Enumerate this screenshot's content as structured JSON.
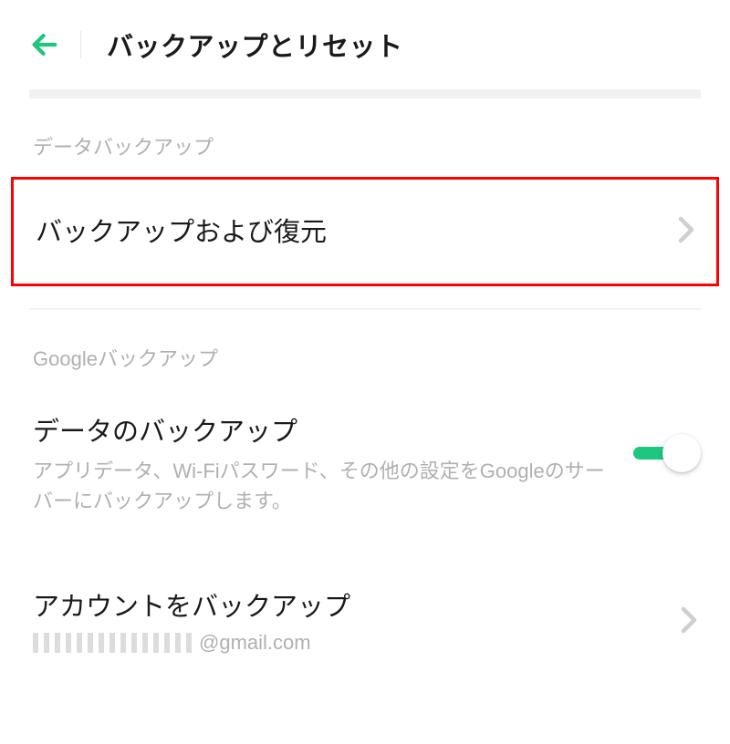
{
  "header": {
    "title": "バックアップとリセット"
  },
  "sections": {
    "data_backup": {
      "label": "データバックアップ",
      "item": {
        "title": "バックアップおよび復元"
      }
    },
    "google_backup": {
      "label": "Googleバックアップ",
      "backup_data": {
        "title": "データのバックアップ",
        "subtitle": "アプリデータ、Wi-Fiパスワード、その他の設定をGoogleのサーバーにバックアップします。",
        "toggle_on": true
      },
      "backup_account": {
        "title": "アカウントをバックアップ",
        "email_domain": "@gmail.com"
      }
    }
  }
}
